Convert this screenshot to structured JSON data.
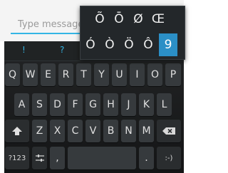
{
  "compose": {
    "placeholder": "Type message"
  },
  "suggestions": [
    "!",
    "?"
  ],
  "keyboard": {
    "row1": [
      "Q",
      "W",
      "E",
      "R",
      "T",
      "Y",
      "U",
      "I",
      "O",
      "P"
    ],
    "row2": [
      "A",
      "S",
      "D",
      "F",
      "G",
      "H",
      "J",
      "K",
      "L"
    ],
    "row3": [
      "Z",
      "X",
      "C",
      "V",
      "B",
      "N",
      "M"
    ],
    "symbols_label": "?123",
    "comma": ",",
    "period": ".",
    "emoji": ":-)"
  },
  "accent_popup": {
    "row1": [
      "Õ",
      "Ō",
      "Ø",
      "Œ"
    ],
    "row2": [
      "Ó",
      "Ò",
      "Ö",
      "Ô",
      "9"
    ],
    "selected": "9"
  },
  "colors": {
    "accent": "#33b5e5",
    "popup_selected": "#2b8fc6"
  }
}
